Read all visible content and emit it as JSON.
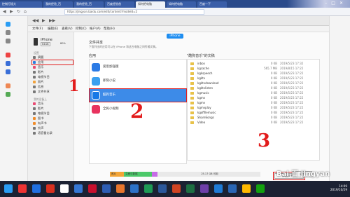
{
  "browser": {
    "tabs": [
      "控制打插大",
      "我的经验_百",
      "我的经验_百",
      "百度经验首",
      "如何把电脑",
      "如何把电脑",
      "百度一下"
    ],
    "address": "https://jingyan.baidu.com/edit/content?modeId=2"
  },
  "itunes": {
    "menu": [
      "文件(F)",
      "编辑(E)",
      "查看(V)",
      "控制(C)",
      "帐户(A)",
      "帮助(H)"
    ],
    "device_button": "iPhone",
    "device": {
      "name": "iPhone",
      "capacity": "64GB",
      "battery": "80%"
    },
    "sidebar": {
      "settings_header": "设置",
      "settings": [
        "摘要",
        "应用",
        "音乐",
        "影片",
        "电视节目",
        "照片",
        "信息",
        "文件共享"
      ],
      "device_header": "我的设备上",
      "device_items": [
        "音乐",
        "影片",
        "电视节目",
        "图书",
        "有声书",
        "铃声",
        "语音备忘录"
      ]
    },
    "file_sharing": {
      "title": "文件共享",
      "desc": "下面列出的应用可以在 iPhone 和这台电脑之间传输文稿。",
      "apps_title": "应用",
      "apps": [
        {
          "name": "爱思加强版",
          "color": "#2c7be5"
        },
        {
          "name": "即刻小说",
          "color": "#3aa0f0"
        },
        {
          "name": "酷狗音乐",
          "color": "#1678e6"
        },
        {
          "name": "全民小视频",
          "color": "#e8335f"
        }
      ],
      "docs_title": "\"酷狗音乐\"的文稿",
      "docs": [
        {
          "name": "inbox",
          "size": "0 KB",
          "date": "2019/5/23 17:32"
        },
        {
          "name": "kgcache",
          "size": "565.7 MB",
          "date": "2019/8/15 17:22"
        },
        {
          "name": "kgkspeech",
          "size": "0 KB",
          "date": "2019/5/23 17:22"
        },
        {
          "name": "kgktv",
          "size": "0 KB",
          "date": "2019/5/23 17:22"
        },
        {
          "name": "kgktvdownload",
          "size": "0 KB",
          "date": "2019/5/23 17:22"
        },
        {
          "name": "kgktvlisten",
          "size": "0 KB",
          "date": "2019/5/23 17:22"
        },
        {
          "name": "kgmusic",
          "size": "0 KB",
          "date": "2019/5/23 17:22"
        },
        {
          "name": "kgmv",
          "size": "0 KB",
          "date": "2019/5/23 17:22"
        },
        {
          "name": "kgmv",
          "size": "0 KB",
          "date": "2019/5/23 17:22"
        },
        {
          "name": "kgmvplay",
          "size": "0 KB",
          "date": "2019/5/23 17:22"
        },
        {
          "name": "kgoffilemusic",
          "size": "0 KB",
          "date": "2019/5/23 17:22"
        },
        {
          "name": "ShareSongs",
          "size": "0 KB",
          "date": "2019/5/23 17:22"
        },
        {
          "name": "Video",
          "size": "0 KB",
          "date": "2019/5/23 17:22"
        }
      ],
      "add_button": "添加文件..."
    },
    "storage": {
      "segments": [
        {
          "label": "照片",
          "color": "#f3a537"
        },
        {
          "label": "文稿与数据",
          "color": "#4cc96a"
        },
        {
          "label": "",
          "color": "#c66be6"
        },
        {
          "label": "25.17 GB 可用",
          "color": "#e9e9e9"
        }
      ],
      "sync_button": "同步"
    }
  },
  "annotations": [
    "1",
    "2",
    "3"
  ],
  "watermark": "Bai 百 jingyan",
  "taskbar": {
    "time": "14:09",
    "date": "2019/10/29",
    "icons": [
      "#2a9df4",
      "#e33",
      "#1f6fe0",
      "#d8301f",
      "#ffffff",
      "#3577d4",
      "#c8102e",
      "#2d5db3",
      "#e8762d",
      "#2c72c7",
      "#1e9a55",
      "#2b579a",
      "#d04423",
      "#1d6f42",
      "#6d3fa8",
      "#1f7bd6",
      "#2a66b5",
      "#ffb900",
      "#13a10e"
    ]
  }
}
